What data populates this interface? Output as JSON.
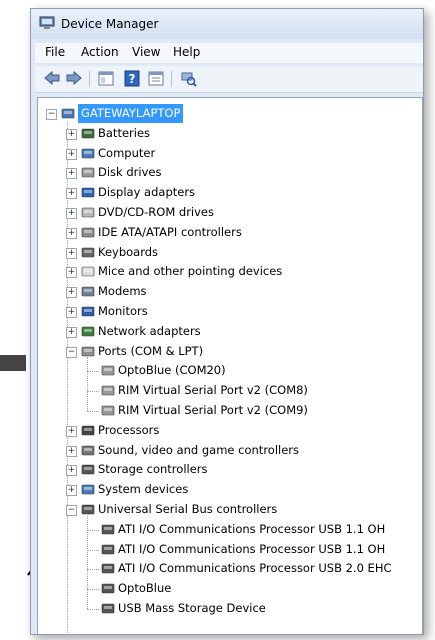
{
  "window": {
    "title": "Device Manager"
  },
  "menu": [
    "File",
    "Action",
    "View",
    "Help"
  ],
  "tree": {
    "root": "GATEWAYLAPTOP",
    "categories": [
      "Batteries",
      "Computer",
      "Disk drives",
      "Display adapters",
      "DVD/CD-ROM drives",
      "IDE ATA/ATAPI controllers",
      "Keyboards",
      "Mice and other pointing devices",
      "Modems",
      "Monitors",
      "Network adapters",
      "Ports (COM & LPT)"
    ],
    "ports": [
      "OptoBlue (COM20)",
      "RIM Virtual Serial Port v2 (COM8)",
      "RIM Virtual Serial Port v2 (COM9)"
    ],
    "categories2": [
      "Processors",
      "Sound, video and game controllers",
      "Storage controllers",
      "System devices",
      "Universal Serial Bus controllers"
    ],
    "usb": [
      "ATI I/O Communications Processor USB 1.1 OH",
      "ATI I/O Communications Processor USB 1.1 OH",
      "ATI I/O Communications Processor USB 2.0 EHC",
      "OptoBlue",
      "USB Mass Storage Device"
    ]
  }
}
